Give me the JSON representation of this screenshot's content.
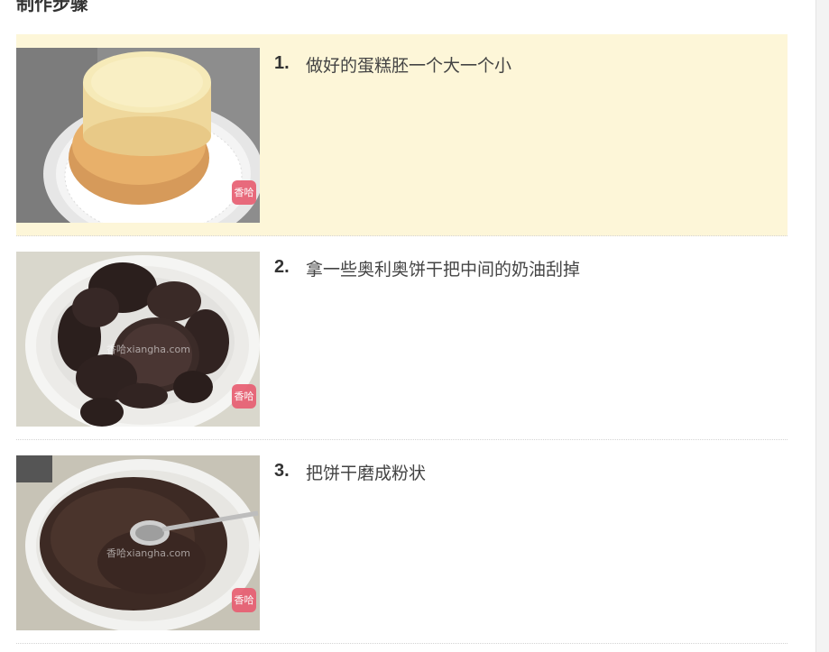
{
  "section": {
    "title": "制作步骤"
  },
  "steps": [
    {
      "number": "1.",
      "text": "做好的蛋糕胚一个大一个小",
      "image_icon": "cake-layers-photo",
      "badge": "香哈",
      "watermark": ""
    },
    {
      "number": "2.",
      "text": "拿一些奥利奥饼干把中间的奶油刮掉",
      "image_icon": "oreo-cookies-bowl-photo",
      "badge": "香哈",
      "watermark": "香哈xiangha.com"
    },
    {
      "number": "3.",
      "text": "把饼干磨成粉状",
      "image_icon": "crushed-cookies-bowl-photo",
      "badge": "香哈",
      "watermark": "香哈xiangha.com"
    }
  ],
  "colors": {
    "highlight_bg": "#fdf6d8",
    "badge": "#e85f72",
    "step_number": "#333333",
    "step_text": "#444444"
  }
}
